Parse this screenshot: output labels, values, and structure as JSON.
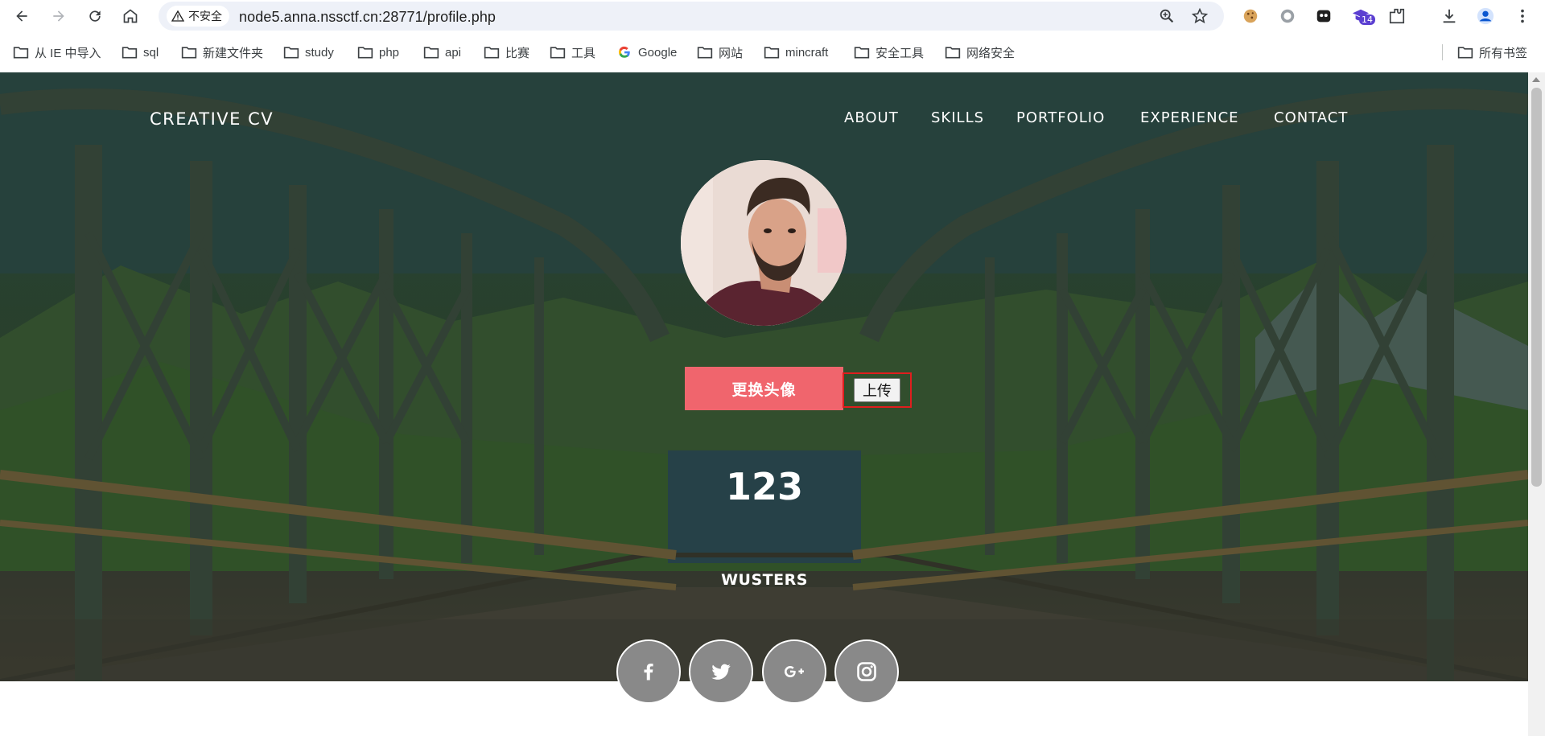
{
  "browser": {
    "security_label": "不安全",
    "url": "node5.anna.nssctf.cn:28771/profile.php",
    "extension_badge": "14"
  },
  "bookmarks": [
    {
      "label": "从 IE 中导入"
    },
    {
      "label": "sql"
    },
    {
      "label": "新建文件夹"
    },
    {
      "label": "study"
    },
    {
      "label": "php"
    },
    {
      "label": "api"
    },
    {
      "label": "比赛"
    },
    {
      "label": "工具"
    },
    {
      "label": "Google"
    },
    {
      "label": "网站"
    },
    {
      "label": "mincraft"
    },
    {
      "label": "安全工具"
    },
    {
      "label": "网络安全"
    }
  ],
  "all_bookmarks_label": "所有书签",
  "site": {
    "brand": "CREATIVE CV",
    "nav": [
      "ABOUT",
      "SKILLS",
      "PORTFOLIO",
      "EXPERIENCE",
      "CONTACT"
    ],
    "change_avatar_label": "更换头像",
    "upload_label": "上传",
    "name": "123",
    "role": "WUSTERS"
  },
  "social_icons": [
    "facebook-icon",
    "twitter-icon",
    "google-plus-icon",
    "instagram-icon"
  ],
  "colors": {
    "accent": "#f0656d",
    "social_bg": "#898989"
  }
}
